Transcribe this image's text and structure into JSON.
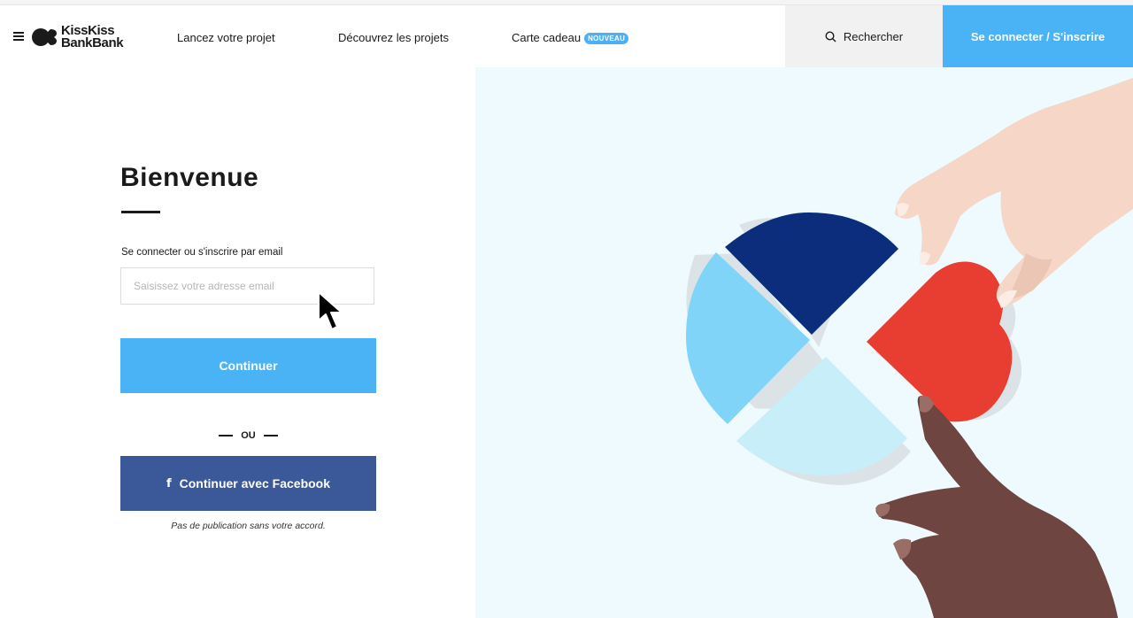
{
  "header": {
    "logo": {
      "line1": "KissKiss",
      "line2": "BankBank"
    },
    "nav": [
      {
        "label": "Lancez votre projet"
      },
      {
        "label": "Découvrez les projets"
      },
      {
        "label": "Carte cadeau",
        "badge": "NOUVEAU"
      }
    ],
    "search_label": "Rechercher",
    "login_label": "Se connecter / S'inscrire"
  },
  "main": {
    "title": "Bienvenue",
    "email_label": "Se connecter ou s'inscrire par email",
    "email_placeholder": "Saisissez votre adresse email",
    "email_value": "",
    "continue_label": "Continuer",
    "or_label": "OU",
    "facebook_label": "Continuer avec Facebook",
    "facebook_note": "Pas de publication sans votre accord."
  },
  "icons": {
    "menu": "menu-icon",
    "logo": "kisskissbankbank-logo",
    "search": "search-icon",
    "facebook": "facebook-icon",
    "cursor": "mouse-pointer-icon"
  },
  "colors": {
    "accent": "#4ab3f6",
    "facebook": "#3b5998",
    "illustration_bg": "#eefafd",
    "dark_blue": "#0b2d7c",
    "light_blue": "#80d4f8",
    "pale_blue": "#c8eefa",
    "heart_red": "#e83e32"
  }
}
